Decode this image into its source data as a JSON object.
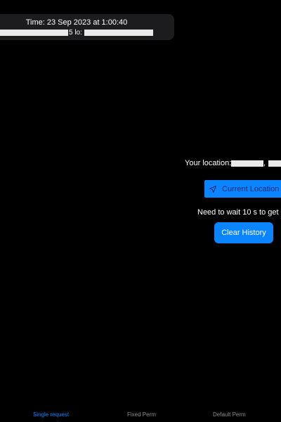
{
  "history": {
    "time_label": "Time: 23 Sep 2023 at 1:00:40",
    "coords_fragment": "5 lo:"
  },
  "location": {
    "label": "Your location:",
    "separator": ","
  },
  "buttons": {
    "current_location": "Current Location",
    "clear_history": "Clear History"
  },
  "status": {
    "wait_text": "Need to wait 10 s to get da"
  },
  "tabs": [
    {
      "label": "Single request",
      "active": true
    },
    {
      "label": "Fixed Perm",
      "active": false
    },
    {
      "label": "Default Perm",
      "active": false
    }
  ],
  "icons": {
    "current_location": "location-arrow-icon"
  },
  "colors": {
    "background": "#000000",
    "accent": "#0a84ff",
    "card": "#1c1c1e",
    "inactive_tab": "#8e8e93"
  }
}
